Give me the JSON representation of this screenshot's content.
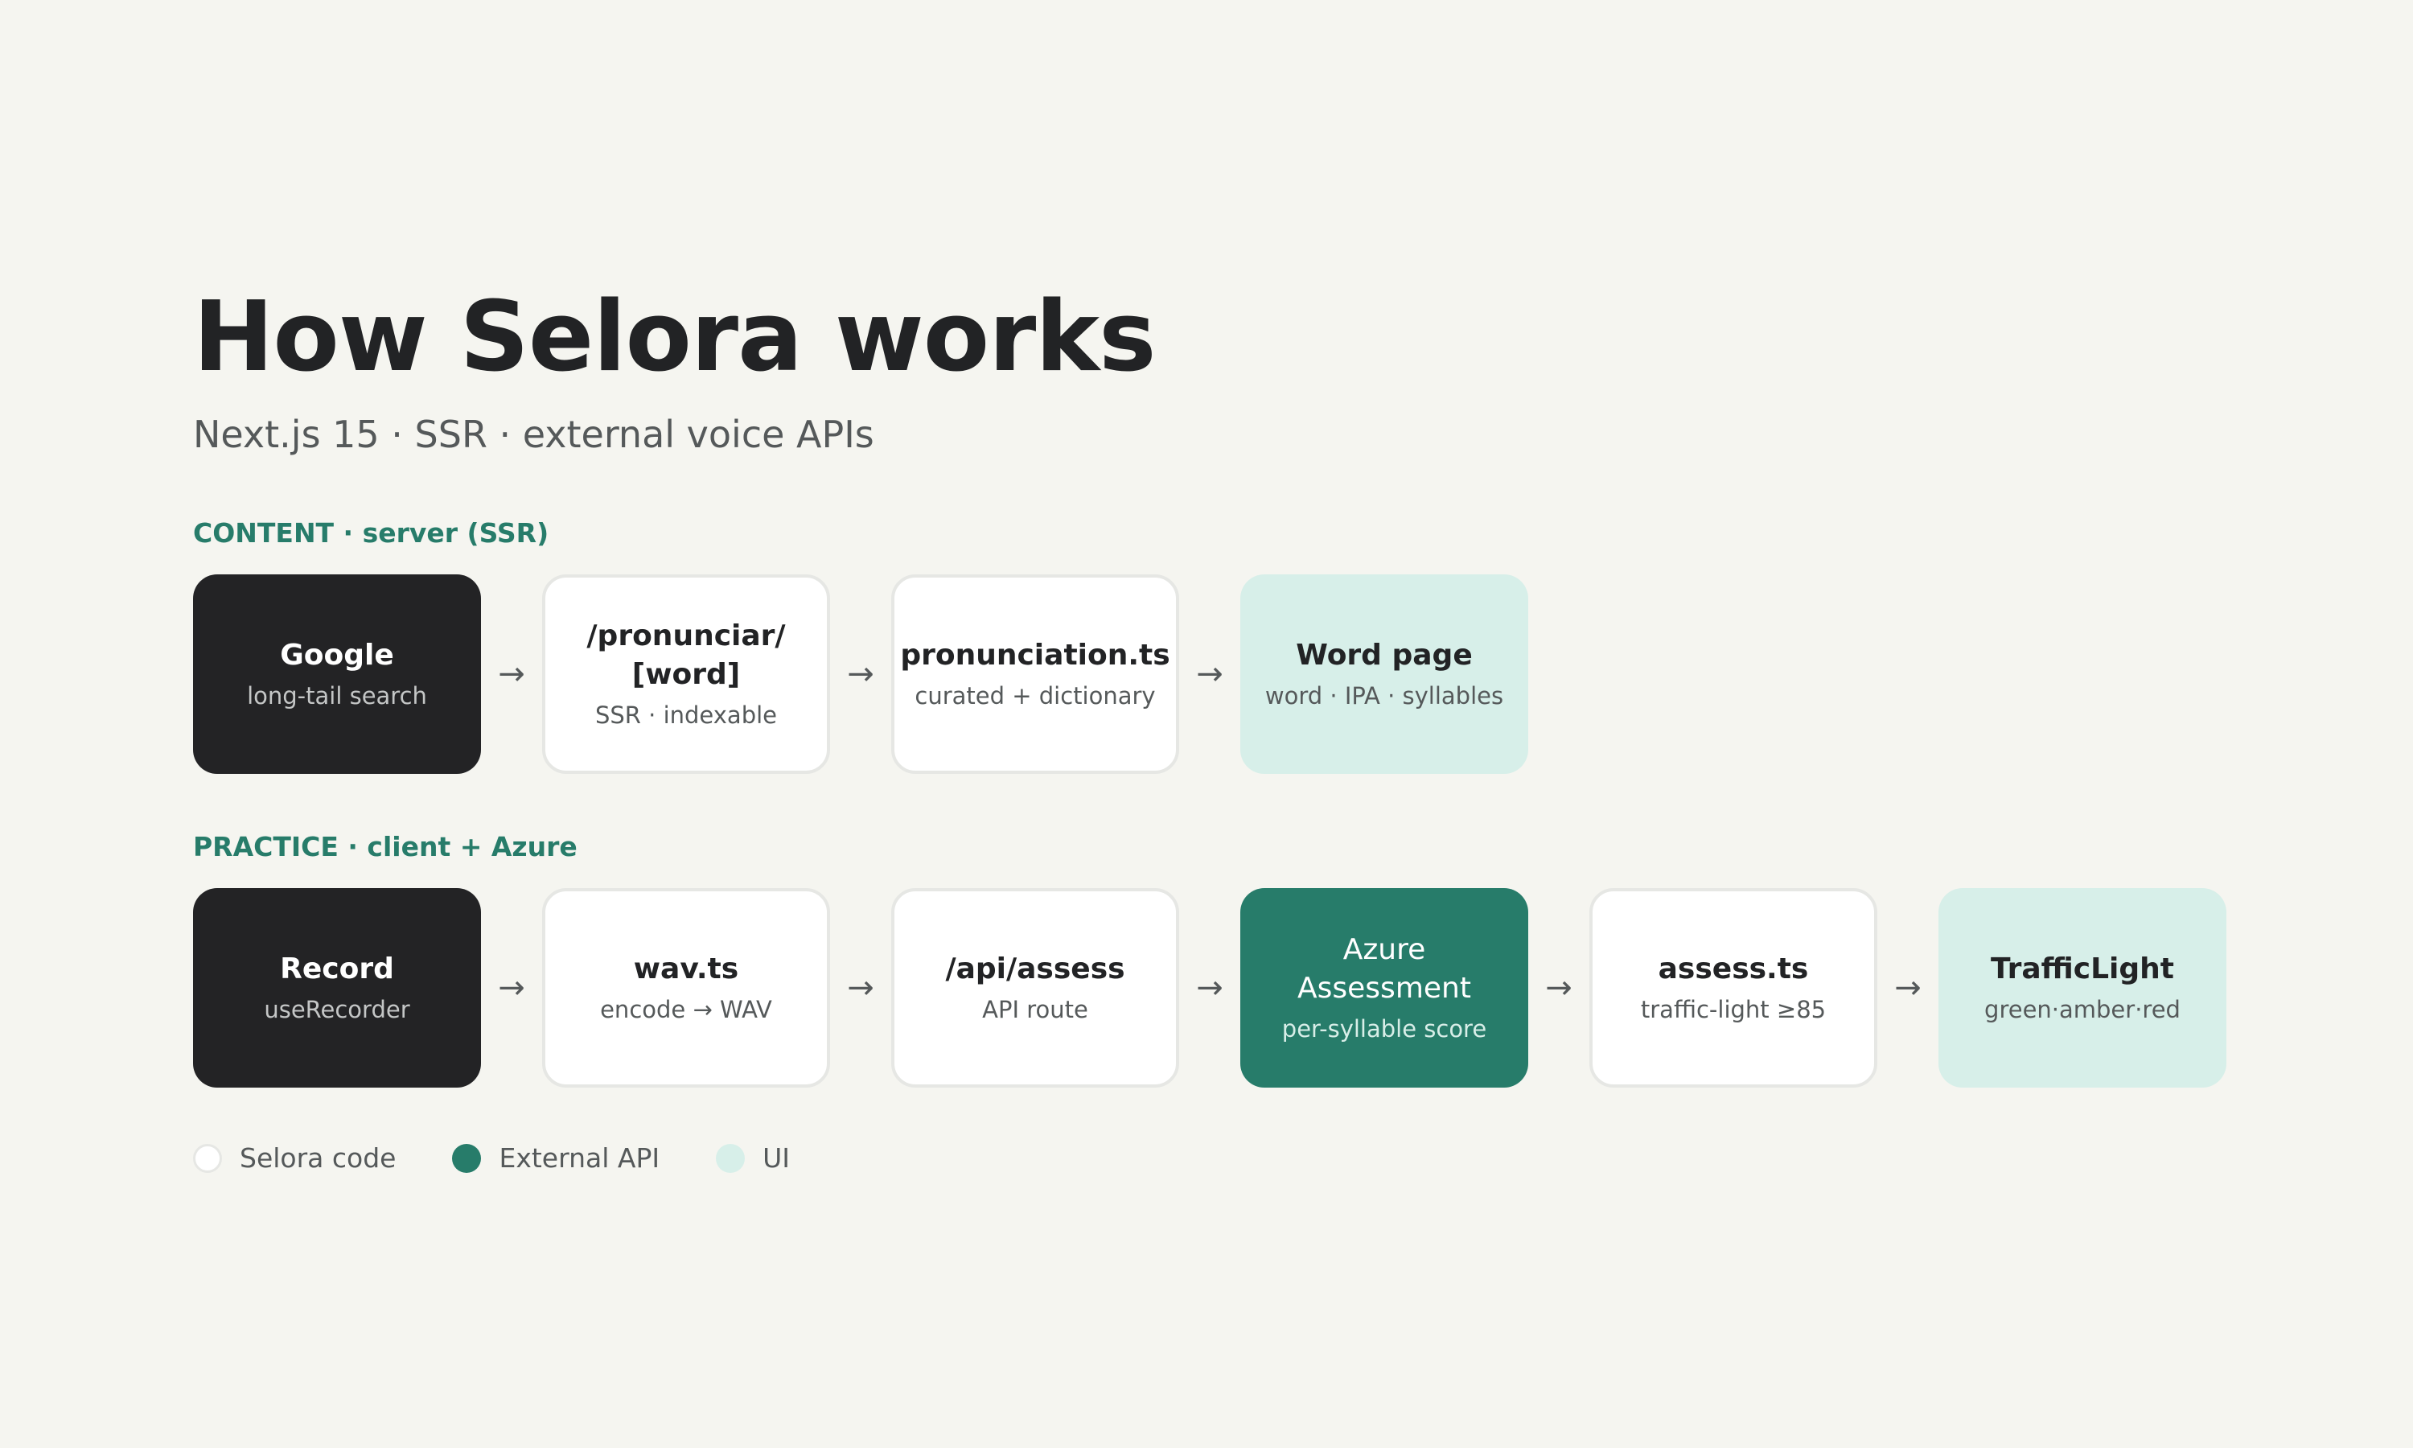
{
  "title": "How Selora works",
  "subtitle": "Next.js 15 · SSR · external voice APIs",
  "sections": [
    {
      "label": "CONTENT · server (SSR)",
      "nodes": [
        {
          "title": "Google",
          "subtitle": "long-tail search",
          "kind": "dark"
        },
        {
          "title": "/pronunciar/ [word]",
          "subtitle": "SSR · indexable",
          "kind": "selora-code"
        },
        {
          "title": "pronunciation.ts",
          "subtitle": "curated + dictionary",
          "kind": "selora-code"
        },
        {
          "title": "Word page",
          "subtitle": "word · IPA · syllables",
          "kind": "ui"
        }
      ]
    },
    {
      "label": "PRACTICE · client + Azure",
      "nodes": [
        {
          "title": "Record",
          "subtitle": "useRecorder",
          "kind": "dark"
        },
        {
          "title": "wav.ts",
          "subtitle": "encode → WAV",
          "kind": "selora-code"
        },
        {
          "title": "/api/assess",
          "subtitle": "API route",
          "kind": "selora-code"
        },
        {
          "title": "Azure Assessment",
          "subtitle": "per-syllable score",
          "kind": "external-api"
        },
        {
          "title": "assess.ts",
          "subtitle": "traffic-light ≥85",
          "kind": "selora-code"
        },
        {
          "title": "TrafficLight",
          "subtitle": "green·amber·red",
          "kind": "ui"
        }
      ]
    }
  ],
  "arrow_glyph": "→",
  "legend": [
    {
      "label": "Selora code",
      "kind": "selora-code"
    },
    {
      "label": "External API",
      "kind": "external-api"
    },
    {
      "label": "UI",
      "kind": "ui"
    }
  ],
  "colors": {
    "background": "#f5f5f0",
    "dark_node": "#232325",
    "external_api": "#277c6a",
    "ui": "#d7efe9",
    "code_border": "#e6e7e4",
    "section_label": "#277c6a"
  }
}
